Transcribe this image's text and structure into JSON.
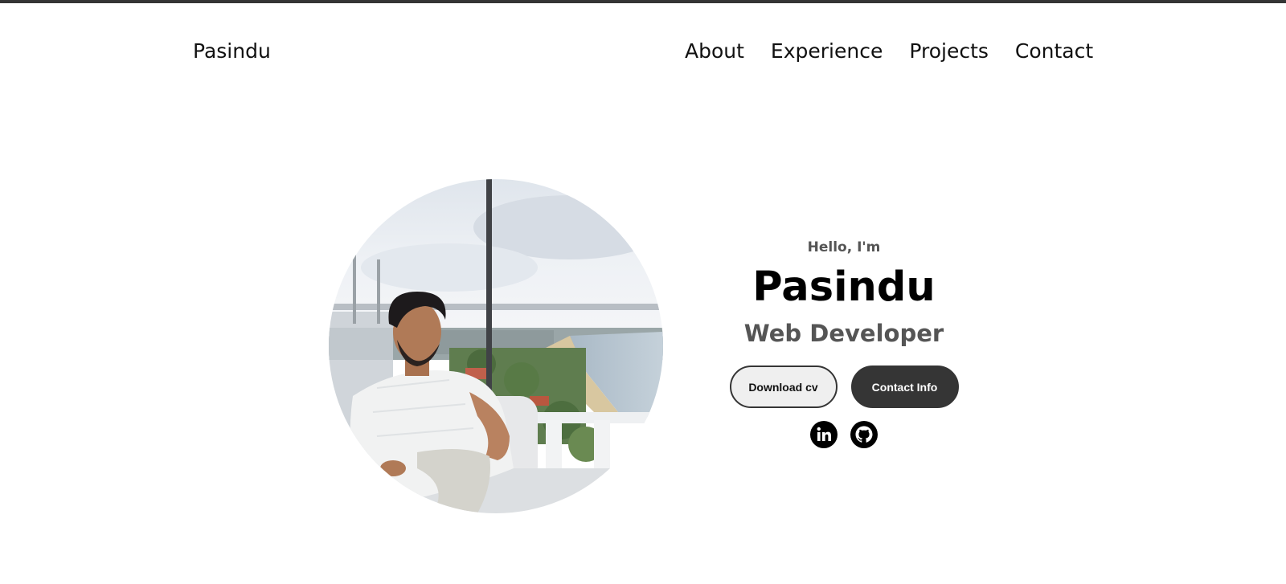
{
  "nav": {
    "logo": "Pasindu",
    "links": [
      "About",
      "Experience",
      "Projects",
      "Contact"
    ]
  },
  "hero": {
    "greeting": "Hello, I'm",
    "name": "Pasindu",
    "title": "Web Developer",
    "buttons": {
      "download": "Download cv",
      "contact": "Contact Info"
    },
    "socials": [
      "linkedin-icon",
      "github-icon"
    ]
  },
  "colors": {
    "accent_dark": "#353535",
    "text_muted": "#555555",
    "button_light": "#efefef"
  }
}
